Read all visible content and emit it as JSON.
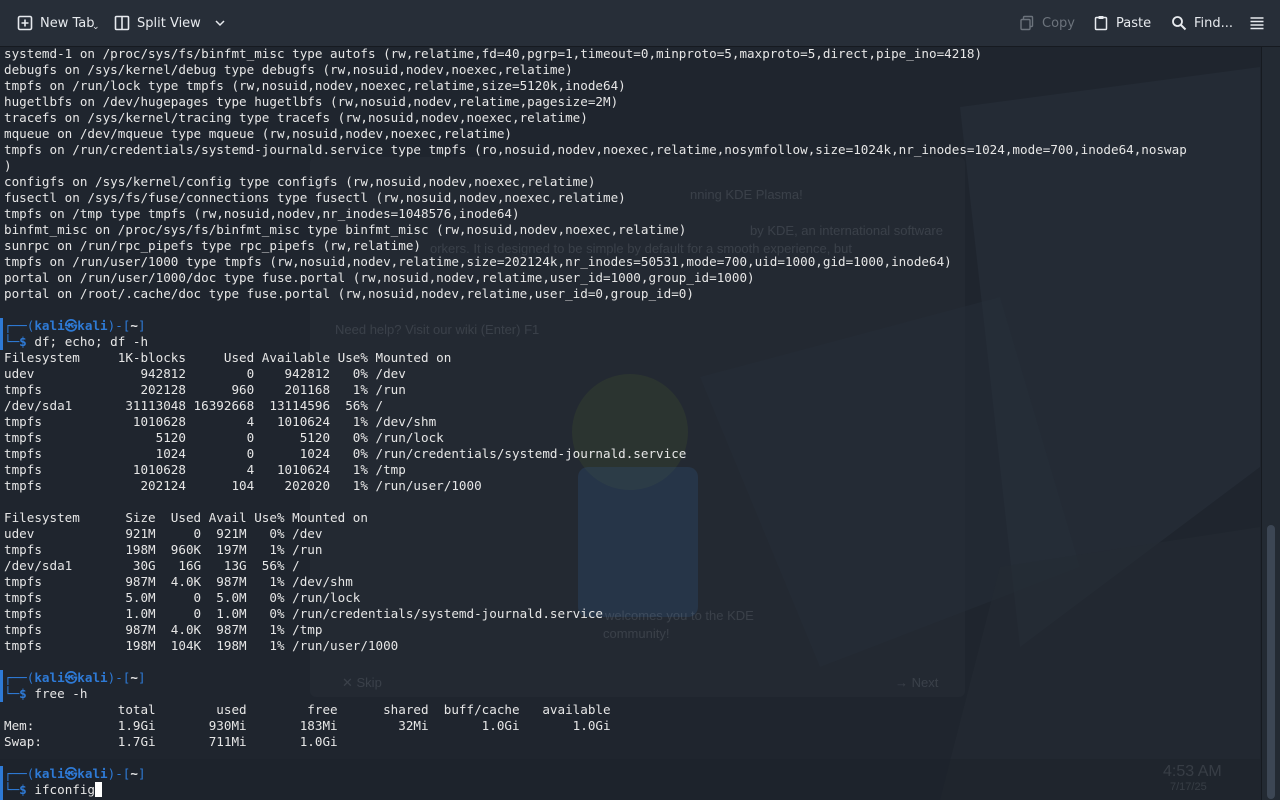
{
  "toolbar": {
    "new_tab": "New Tab",
    "split_view": "Split View",
    "copy": "Copy",
    "paste": "Paste",
    "find": "Find...",
    "icons": {
      "new_tab": "new-tab-icon",
      "split_view": "split-view-icon",
      "split_dropdown": "chevron-down-icon",
      "copy": "copy-icon",
      "paste": "paste-icon",
      "find": "search-icon",
      "menu": "hamburger-menu-icon"
    }
  },
  "prompt": {
    "user": "kali",
    "host": "kali",
    "path": "~",
    "symbol": "$"
  },
  "mount_output": [
    "systemd-1 on /proc/sys/fs/binfmt_misc type autofs (rw,relatime,fd=40,pgrp=1,timeout=0,minproto=5,maxproto=5,direct,pipe_ino=4218)",
    "debugfs on /sys/kernel/debug type debugfs (rw,nosuid,nodev,noexec,relatime)",
    "tmpfs on /run/lock type tmpfs (rw,nosuid,nodev,noexec,relatime,size=5120k,inode64)",
    "hugetlbfs on /dev/hugepages type hugetlbfs (rw,nosuid,nodev,relatime,pagesize=2M)",
    "tracefs on /sys/kernel/tracing type tracefs (rw,nosuid,nodev,noexec,relatime)",
    "mqueue on /dev/mqueue type mqueue (rw,nosuid,nodev,noexec,relatime)",
    "tmpfs on /run/credentials/systemd-journald.service type tmpfs (ro,nosuid,nodev,noexec,relatime,nosymfollow,size=1024k,nr_inodes=1024,mode=700,inode64,noswap",
    ")",
    "configfs on /sys/kernel/config type configfs (rw,nosuid,nodev,noexec,relatime)",
    "fusectl on /sys/fs/fuse/connections type fusectl (rw,nosuid,nodev,noexec,relatime)",
    "tmpfs on /tmp type tmpfs (rw,nosuid,nodev,nr_inodes=1048576,inode64)",
    "binfmt_misc on /proc/sys/fs/binfmt_misc type binfmt_misc (rw,nosuid,nodev,noexec,relatime)",
    "sunrpc on /run/rpc_pipefs type rpc_pipefs (rw,relatime)",
    "tmpfs on /run/user/1000 type tmpfs (rw,nosuid,nodev,relatime,size=202124k,nr_inodes=50531,mode=700,uid=1000,gid=1000,inode64)",
    "portal on /run/user/1000/doc type fuse.portal (rw,nosuid,nodev,relatime,user_id=1000,group_id=1000)",
    "portal on /root/.cache/doc type fuse.portal (rw,nosuid,nodev,relatime,user_id=0,group_id=0)"
  ],
  "commands": [
    {
      "cmd": "df; echo; df -h",
      "output": [
        "Filesystem     1K-blocks     Used Available Use% Mounted on",
        "udev              942812        0    942812   0% /dev",
        "tmpfs             202128      960    201168   1% /run",
        "/dev/sda1       31113048 16392668  13114596  56% /",
        "tmpfs            1010628        4   1010624   1% /dev/shm",
        "tmpfs               5120        0      5120   0% /run/lock",
        "tmpfs               1024        0      1024   0% /run/credentials/systemd-journald.service",
        "tmpfs            1010628        4   1010624   1% /tmp",
        "tmpfs             202124      104    202020   1% /run/user/1000",
        "",
        "Filesystem      Size  Used Avail Use% Mounted on",
        "udev            921M     0  921M   0% /dev",
        "tmpfs           198M  960K  197M   1% /run",
        "/dev/sda1        30G   16G   13G  56% /",
        "tmpfs           987M  4.0K  987M   1% /dev/shm",
        "tmpfs           5.0M     0  5.0M   0% /run/lock",
        "tmpfs           1.0M     0  1.0M   0% /run/credentials/systemd-journald.service",
        "tmpfs           987M  4.0K  987M   1% /tmp",
        "tmpfs           198M  104K  198M   1% /run/user/1000",
        ""
      ]
    },
    {
      "cmd": "free -h",
      "output": [
        "               total        used        free      shared  buff/cache   available",
        "Mem:           1.9Gi       930Mi       183Mi        32Mi       1.0Gi       1.0Gi",
        "Swap:          1.7Gi       711Mi       1.0Gi",
        ""
      ]
    },
    {
      "cmd": "ifconfig",
      "output": []
    }
  ],
  "background_ghost_text": {
    "line1": "nning KDE Plasma!",
    "line2": "by KDE, an international software",
    "line3": "orkers. It is designed to be simple by default for a smooth experience, but",
    "line4": "Need help? Visit our wiki (Enter) F1",
    "line5": "welcomes you to the KDE",
    "line6": "community!",
    "skip": "✕ Skip",
    "next": "→ Next",
    "clock_time": "4:53 AM",
    "clock_date": "7/17/25"
  },
  "colors": {
    "terminal_bg": "#1f252e",
    "prompt_accent": "#2e7ad6",
    "text": "#e6e6e6",
    "toolbar_bg": "#272e38"
  }
}
